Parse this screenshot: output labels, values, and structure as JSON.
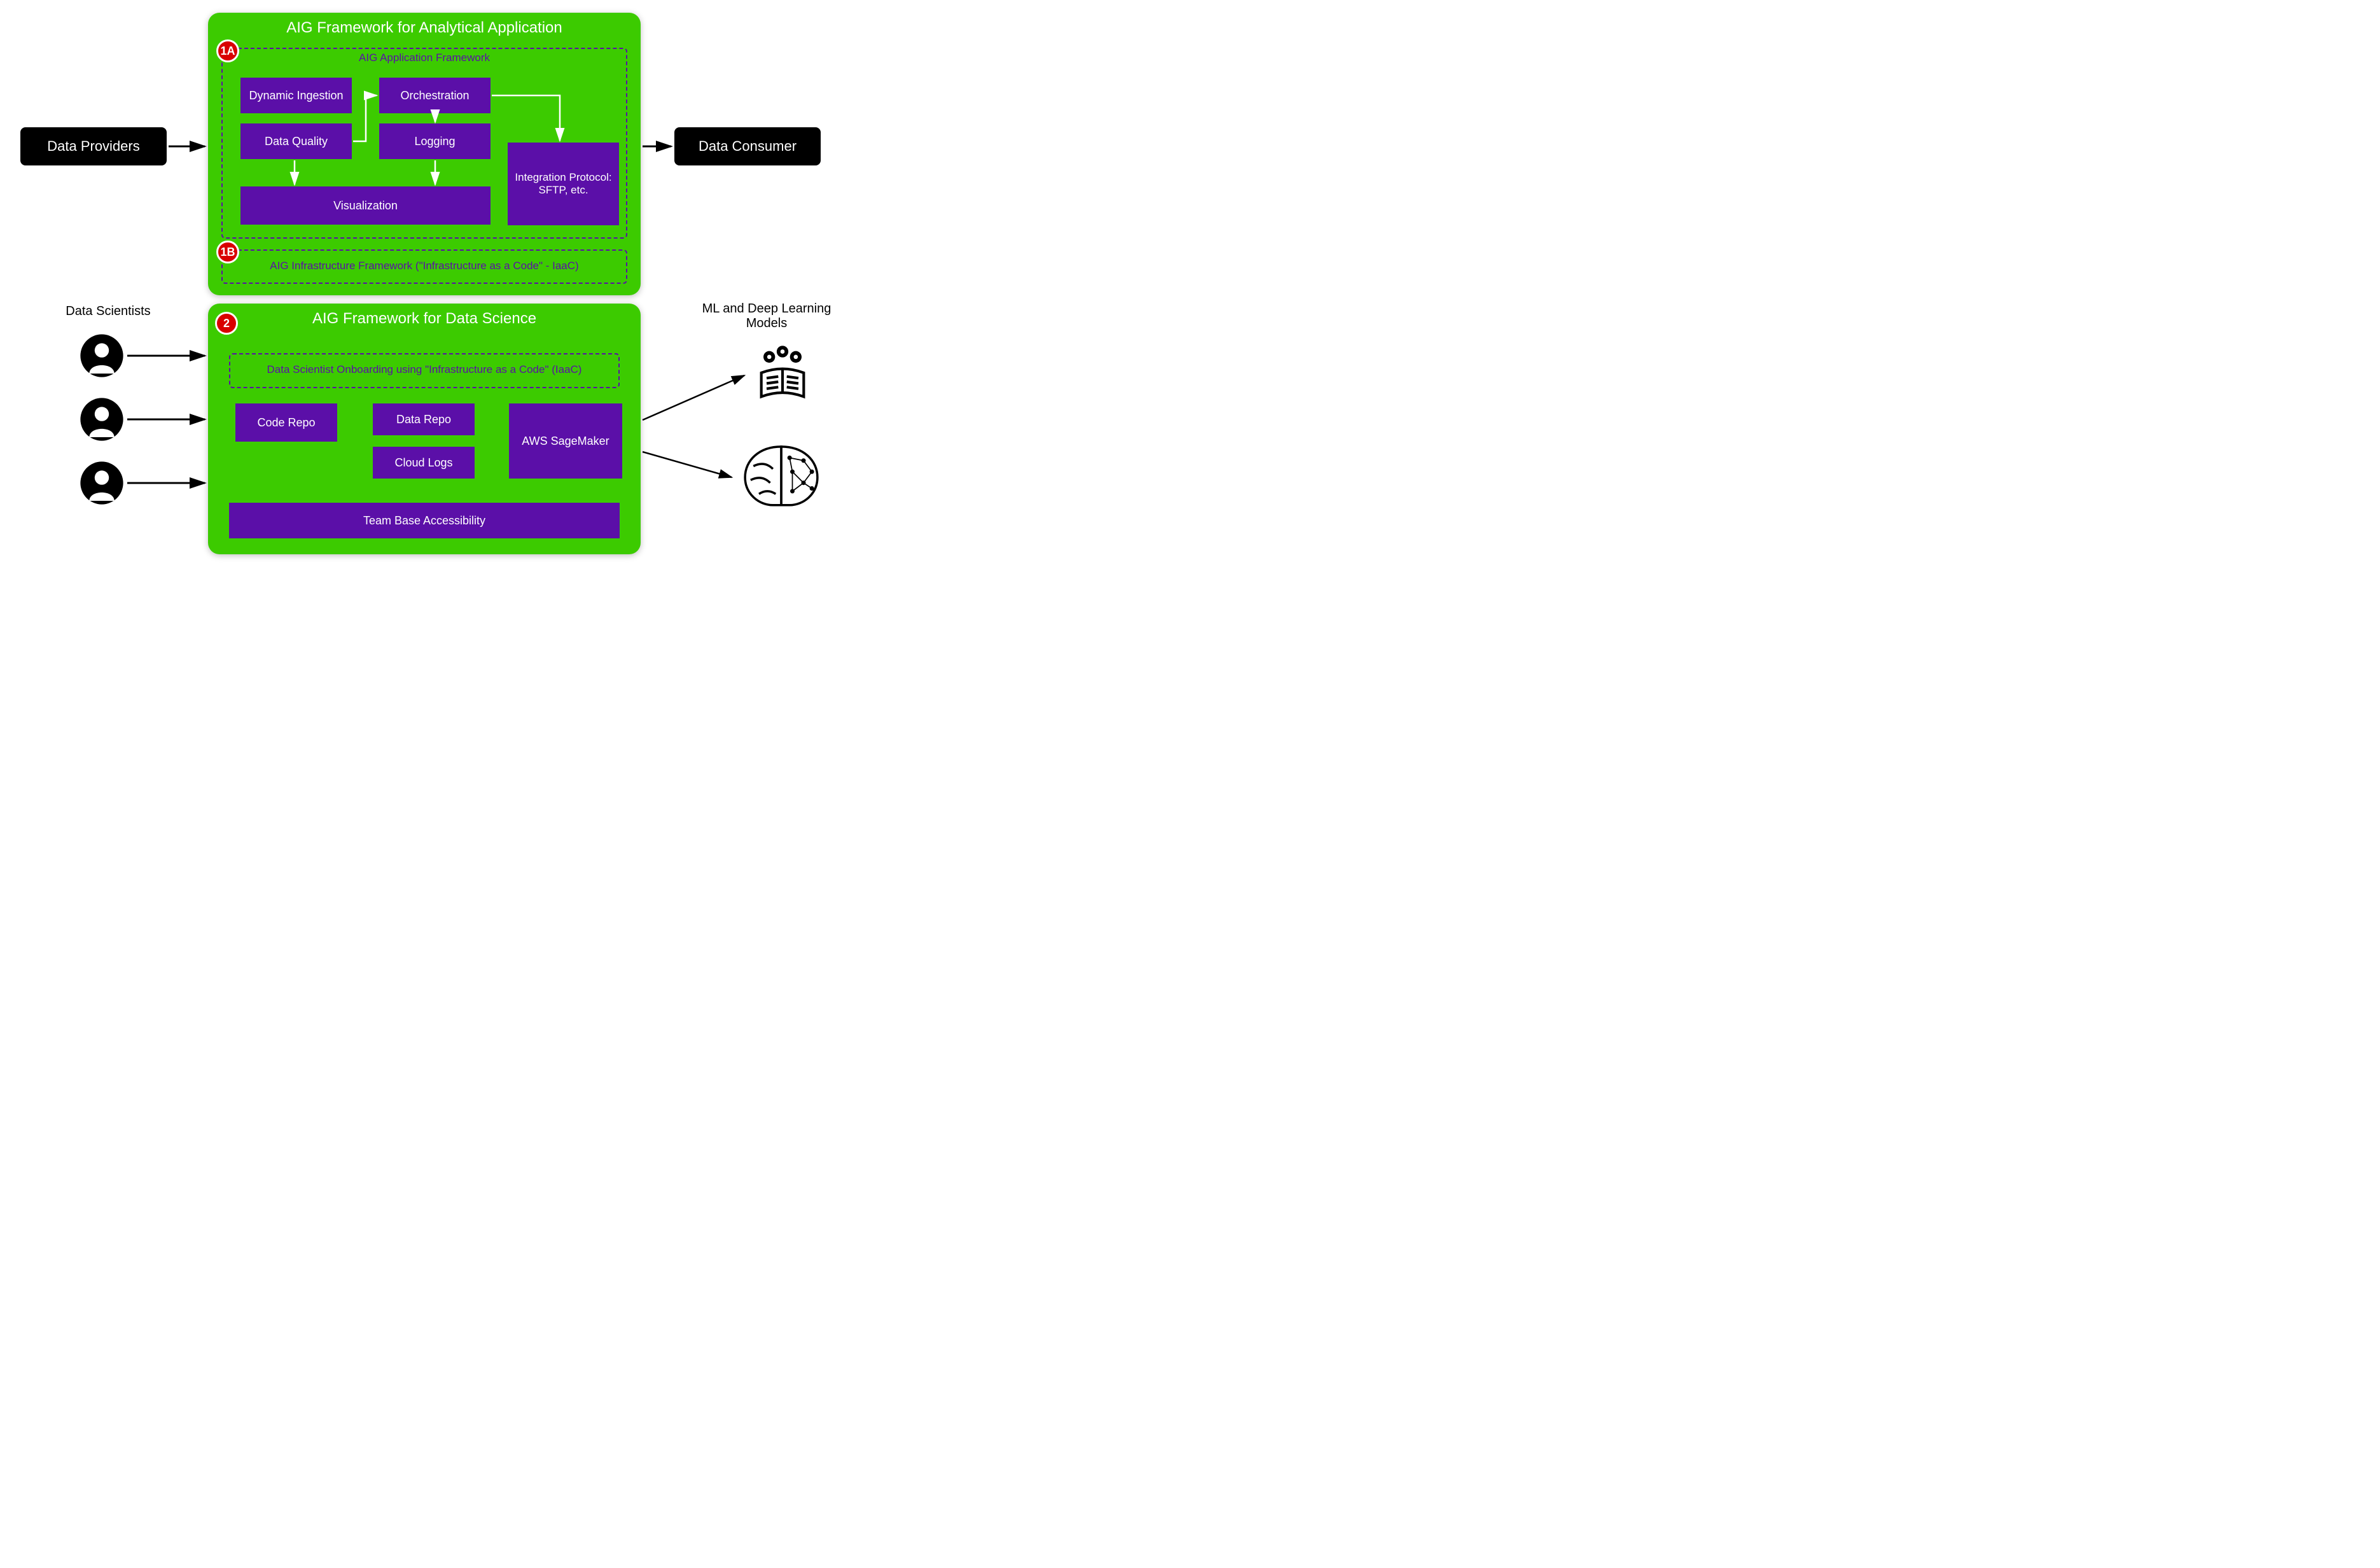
{
  "colors": {
    "green": "#3ccb00",
    "purple": "#5b0fa8",
    "badge_red": "#d90000",
    "black": "#000000",
    "white": "#ffffff"
  },
  "external": {
    "data_providers": "Data Providers",
    "data_consumer": "Data Consumer",
    "data_scientists_label": "Data Scientists",
    "ml_models_label": "ML and Deep Learning Models"
  },
  "panel1": {
    "title": "AIG Framework for Analytical Application",
    "badge_1a": "1A",
    "badge_1b": "1B",
    "app_framework_label": "AIG Application Framework",
    "infra_framework_label": "AIG Infrastructure Framework  (\"Infrastructure as a Code\" - IaaC)",
    "blocks": {
      "dynamic_ingestion": "Dynamic Ingestion",
      "orchestration": "Orchestration",
      "data_quality": "Data Quality",
      "logging": "Logging",
      "integration": "Integration Protocol: SFTP, etc.",
      "visualization": "Visualization"
    }
  },
  "panel2": {
    "title": "AIG Framework for Data Science",
    "badge_2": "2",
    "onboarding_label": "Data Scientist Onboarding using \"Infrastructure as a Code\" (IaaC)",
    "blocks": {
      "code_repo": "Code Repo",
      "data_repo": "Data Repo",
      "cloud_logs": "Cloud Logs",
      "sagemaker": "AWS SageMaker",
      "team_access": "Team Base Accessibility"
    }
  }
}
